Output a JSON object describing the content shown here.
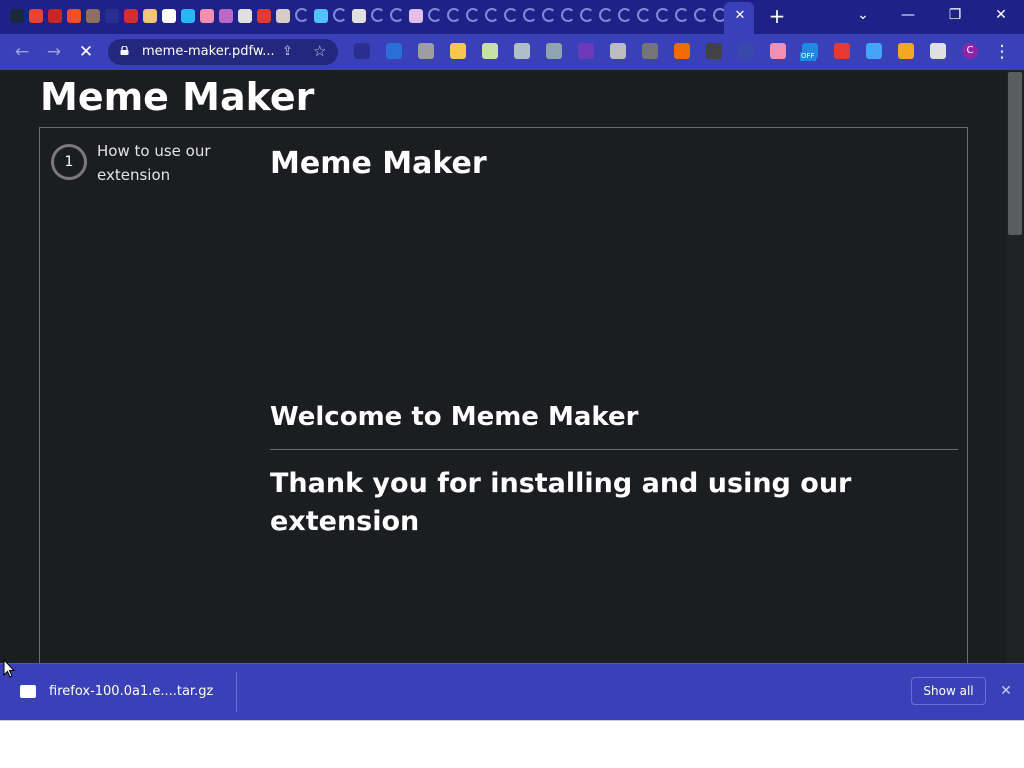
{
  "tabstrip": {
    "active_tab_close": "✕",
    "new_tab": "+",
    "window_controls": {
      "tab_search": "⌄",
      "minimize": "—",
      "restore": "❐",
      "close": "✕"
    },
    "tab_icons": [
      {
        "name": "steam-icon",
        "color": "#1b2838"
      },
      {
        "name": "gmail-icon",
        "color": "#ea4335"
      },
      {
        "name": "red-badge-icon",
        "color": "#c62828"
      },
      {
        "name": "microsoft-icon",
        "color": "#f25022"
      },
      {
        "name": "game-icon",
        "color": "#8d6e63"
      },
      {
        "name": "blank-tab-icon",
        "color": "#2a2e90"
      },
      {
        "name": "red-arrow-icon",
        "color": "#d32f2f"
      },
      {
        "name": "parchment-icon",
        "color": "#f2c37a"
      },
      {
        "name": "google-icon",
        "color": "#ffffff"
      },
      {
        "name": "cyan-circle-icon",
        "color": "#29b6f6"
      },
      {
        "name": "pink-circle-icon",
        "color": "#f48fb1"
      },
      {
        "name": "magenta-circle-icon",
        "color": "#ba68c8"
      },
      {
        "name": "document-icon",
        "color": "#e0e0e0"
      },
      {
        "name": "red-square-icon",
        "color": "#e53935"
      },
      {
        "name": "page-icon",
        "color": "#d7ccc8"
      },
      {
        "name": "shield-icon",
        "color": "#4fc3f7"
      },
      {
        "name": "chrome-icon",
        "color": "#e0e0e0"
      },
      {
        "name": "chat-bubble-icon",
        "color": "#e1bee7"
      }
    ]
  },
  "toolbar": {
    "back": "←",
    "forward": "→",
    "reload": "✕",
    "url": "meme-maker.pdfw...",
    "share": "⇪",
    "bookmark": "☆",
    "menu": "⋮",
    "extensions": [
      {
        "name": "rss-extension-icon",
        "color": "#2a2e90"
      },
      {
        "name": "vpn-extension-icon",
        "color": "#2a6ed8"
      },
      {
        "name": "hammer-extension-icon",
        "color": "#9e9e9e"
      },
      {
        "name": "emoji-extension-icon",
        "color": "#f9c74f"
      },
      {
        "name": "grid-extension-icon",
        "color": "#c5e1a5"
      },
      {
        "name": "cross-tools-extension-icon",
        "color": "#b0bec5"
      },
      {
        "name": "k-extension-icon",
        "color": "#90a4ae"
      },
      {
        "name": "purple-k-extension-icon",
        "color": "#6a3ab8"
      },
      {
        "name": "chat-extension-icon",
        "color": "#bdbdbd"
      },
      {
        "name": "s-extension-icon",
        "color": "#757575"
      },
      {
        "name": "google-translate-extension-icon",
        "color": "#ef6c00"
      },
      {
        "name": "dark-extension-icon",
        "color": "#424242"
      },
      {
        "name": "dots-extension-icon",
        "color": "#3949ab"
      },
      {
        "name": "pink-extension-icon",
        "color": "#f48fb1"
      },
      {
        "name": "off-extension-icon",
        "color": "#1e88e5"
      },
      {
        "name": "red-bar-extension-icon",
        "color": "#e53935"
      },
      {
        "name": "play-extension-icon",
        "color": "#42a5f5"
      },
      {
        "name": "fox-extension-icon",
        "color": "#f5a623"
      },
      {
        "name": "puzzle-extension-icon",
        "color": "#e0e0e0"
      },
      {
        "name": "profile-avatar",
        "color": "#8e24aa",
        "letter": "C"
      }
    ],
    "off_badge": "OFF"
  },
  "page": {
    "title": "Meme Maker",
    "step": {
      "number": "1",
      "label": "How to use our extension"
    },
    "content_title": "Meme Maker",
    "welcome": "Welcome to Meme Maker",
    "thanks": "Thank you for installing and using our extension"
  },
  "download_shelf": {
    "filename": "firefox-100.0a1.e....tar.gz",
    "chevron": "⌃",
    "show_all": "Show all",
    "close": "✕"
  },
  "colors": {
    "tabstrip": "#1e2288",
    "toolbar": "#3a40b8",
    "page_background": "#1b1d21",
    "panel_border": "#6a6b70"
  }
}
